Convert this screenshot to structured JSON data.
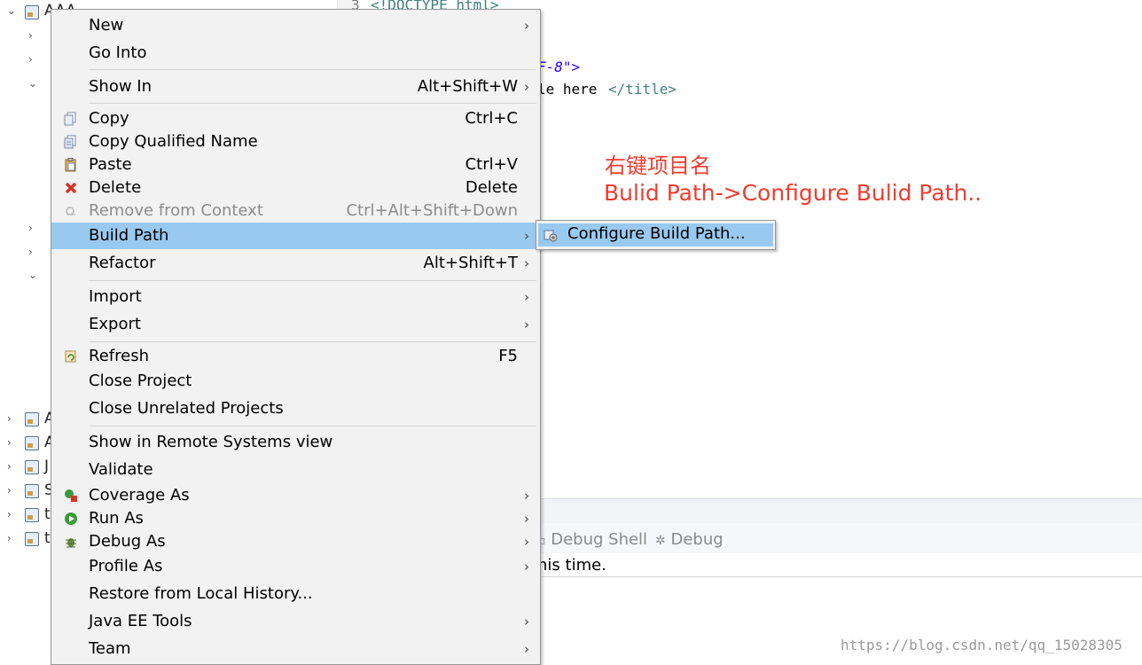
{
  "explorer": {
    "top_project": "AAA",
    "bottom_letters": [
      "A",
      "A",
      "J",
      "S",
      "t",
      "t"
    ]
  },
  "editor": {
    "line_number": "3",
    "line3": "<!DOCTYPE html>",
    "charset_fragment": "F-8\">",
    "title_text": "le here",
    "title_close": "</title>"
  },
  "annotation": {
    "line1": "右键项目名",
    "line2": "Bulid Path->Configure Bulid Path.."
  },
  "console": {
    "tab_debug_shell": "Debug Shell",
    "tab_debug": "Debug",
    "message_fragment": "his time."
  },
  "menu": {
    "items": [
      {
        "label": "New",
        "accel": "",
        "submenu": true
      },
      {
        "label": "Go Into",
        "accel": "",
        "submenu": false
      },
      {
        "label": "Show In",
        "accel": "Alt+Shift+W",
        "submenu": true
      },
      {
        "label": "Copy",
        "accel": "Ctrl+C",
        "submenu": false
      },
      {
        "label": "Copy Qualified Name",
        "accel": "",
        "submenu": false
      },
      {
        "label": "Paste",
        "accel": "Ctrl+V",
        "submenu": false
      },
      {
        "label": "Delete",
        "accel": "Delete",
        "submenu": false
      },
      {
        "label": "Remove from Context",
        "accel": "Ctrl+Alt+Shift+Down",
        "submenu": false,
        "disabled": true
      },
      {
        "label": "Build Path",
        "accel": "",
        "submenu": true,
        "highlighted": true
      },
      {
        "label": "Refactor",
        "accel": "Alt+Shift+T",
        "submenu": true
      },
      {
        "label": "Import",
        "accel": "",
        "submenu": true
      },
      {
        "label": "Export",
        "accel": "",
        "submenu": true
      },
      {
        "label": "Refresh",
        "accel": "F5",
        "submenu": false
      },
      {
        "label": "Close Project",
        "accel": "",
        "submenu": false
      },
      {
        "label": "Close Unrelated Projects",
        "accel": "",
        "submenu": false
      },
      {
        "label": "Show in Remote Systems view",
        "accel": "",
        "submenu": false
      },
      {
        "label": "Validate",
        "accel": "",
        "submenu": false
      },
      {
        "label": "Coverage As",
        "accel": "",
        "submenu": true
      },
      {
        "label": "Run As",
        "accel": "",
        "submenu": true
      },
      {
        "label": "Debug As",
        "accel": "",
        "submenu": true
      },
      {
        "label": "Profile As",
        "accel": "",
        "submenu": true
      },
      {
        "label": "Restore from Local History...",
        "accel": "",
        "submenu": false
      },
      {
        "label": "Java EE Tools",
        "accel": "",
        "submenu": true
      },
      {
        "label": "Team",
        "accel": "",
        "submenu": true
      }
    ],
    "submenu_arrow": "›"
  },
  "submenu": {
    "label": "Configure Build Path..."
  },
  "watermark": "https://blog.csdn.net/qq_15028305",
  "colors": {
    "highlight": "#99c9ef",
    "annotation": "#f23b2f",
    "menu_bg": "#f2f2f2"
  }
}
